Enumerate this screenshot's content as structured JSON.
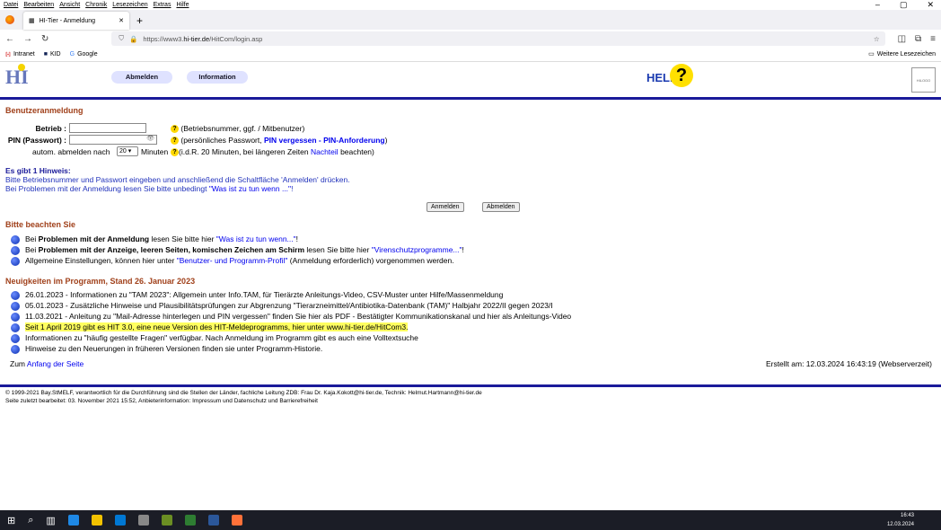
{
  "menubar": [
    "Datei",
    "Bearbeiten",
    "Ansicht",
    "Chronik",
    "Lesezeichen",
    "Extras",
    "Hilfe"
  ],
  "tab": {
    "title": "HI-Tier - Anmeldung",
    "close": "✕",
    "new": "+"
  },
  "window": {
    "min": "–",
    "max": "▢",
    "close": "✕"
  },
  "url": {
    "pre": "https://www3.",
    "host": "hi-tier.de",
    "path": "/HitCom/login.asp"
  },
  "bookmarks": [
    "Intranet",
    "KID",
    "Google"
  ],
  "bookmarks_right": "Weitere Lesezeichen",
  "nav": {
    "left": "Abmelden",
    "right": "Information"
  },
  "help": "HELP",
  "mini": "HILOGO",
  "sections": {
    "login": "Benutzeranmeldung",
    "note": "Bitte beachten Sie",
    "news": "Neuigkeiten im Programm, Stand 26. Januar 2023"
  },
  "form": {
    "betrieb_label": "Betrieb :",
    "betrieb_hint": "(Betriebsnummer, ggf. / Mitbenutzer)",
    "pin_label": "PIN (Passwort) :",
    "pin_hint_a": "(persönliches Passwort,",
    "pin_link": "PIN vergessen - PIN-Anforderung",
    "pin_hint_b": ")",
    "auto_a": "autom. abmelden nach",
    "auto_val": "20",
    "auto_b": "Minuten",
    "auto_hint_a": "(i.d.R. 20 Minuten, bei längeren Zeiten",
    "auto_link": "Nachteil",
    "auto_hint_b": "beachten)"
  },
  "hint": {
    "title": "Es gibt 1 Hinweis:",
    "l1": "Bitte Betriebsnummer und Passwort eingeben und anschließend die Schaltfläche 'Anmelden' drücken.",
    "l2a": "Bei Problemen mit der Anmeldung lesen Sie bitte unbedingt",
    "l2link": "\"Was ist zu tun wenn ...\"",
    "l2b": "!"
  },
  "buttons": {
    "login": "Anmelden",
    "logout": "Abmelden"
  },
  "notes": [
    {
      "a": "Bei",
      "b": "Problemen mit der Anmeldung",
      "c": "lesen Sie bitte hier",
      "link": "\"Was ist zu tun wenn...\"",
      "d": "!"
    },
    {
      "a": "Bei",
      "b": "Problemen mit der Anzeige, leeren Seiten, komischen Zeichen am Schirm",
      "c": "lesen Sie bitte hier",
      "link": "\"Virenschutzprogramme...\"",
      "d": "!"
    },
    {
      "a": "Allgemeine Einstellungen, können hier unter",
      "b": "",
      "c": "",
      "link": "\"Benutzer- und Programm-Profil\"",
      "d": "(Anmeldung erforderlich) vorgenommen werden."
    }
  ],
  "news": [
    "26.01.2023 - Informationen zu \"TAM 2023\": Allgemein unter Info.TAM, für Tierärzte Anleitungs-Video, CSV-Muster unter Hilfe/Massenmeldung",
    "05.01.2023 - Zusätzliche Hinweise und Plausibilitätsprüfungen zur Abgrenzung \"Tierarzneimittel/Antibiotika-Datenbank (TAM)\" Halbjahr 2022/II gegen 2023/I",
    "11.03.2021 - Anleitung zu \"Mail-Adresse hinterlegen und PIN vergessen\" finden Sie hier als PDF - Bestätigter Kommunikationskanal und hier als Anleitungs-Video",
    "Seit 1 April 2019 gibt es HIT 3.0, eine neue Version des HIT-Meldeprogramms, hier unter www.hi-tier.de/HitCom3.",
    "Informationen zu \"häufig gestellte Fragen\" verfügbar. Nach Anmeldung im Programm gibt es auch eine Volltextsuche",
    "Hinweise zu den Neuerungen in früheren Versionen finden sie unter Programm-Historie."
  ],
  "top": {
    "a": "Zum",
    "link": "Anfang der Seite"
  },
  "created": "Erstellt am: 12.03.2024 16:43:19 (Webserverzeit)",
  "footer": {
    "l1": "© 1999-2021 Bay.StMELF, verantwortlich für die Durchführung sind die Stellen der Länder, fachliche Leitung ZDB: Frau Dr. Kaja.Kokott@hi-tier.de, Technik: Helmut.Hartmann@hi-tier.de",
    "l2": "Seite zuletzt bearbeitet: 03. November 2021 15:52, Anbieterinformation: Impressum und Datenschutz und Barrierefreiheit"
  },
  "clock": {
    "time": "16:43",
    "date": "12.03.2024"
  }
}
